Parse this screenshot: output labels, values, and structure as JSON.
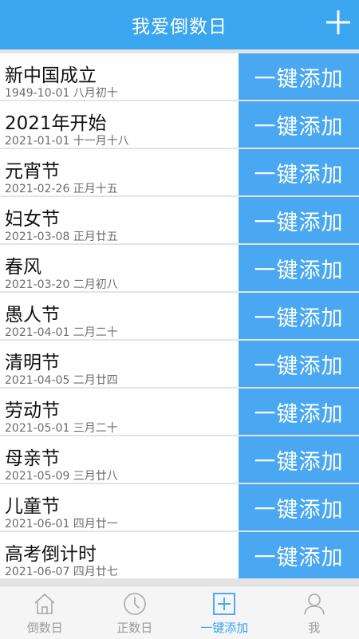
{
  "header": {
    "title": "我爱倒数日",
    "add_icon": "plus-icon"
  },
  "list": {
    "button_label": "一键添加",
    "items": [
      {
        "name": "新中国成立",
        "date": "1949-10-01 八月初十"
      },
      {
        "name": "2021年开始",
        "date": "2021-01-01 十一月十八"
      },
      {
        "name": "元宵节",
        "date": "2021-02-26 正月十五"
      },
      {
        "name": "妇女节",
        "date": "2021-03-08 正月廿五"
      },
      {
        "name": "春风",
        "date": "2021-03-20 二月初八"
      },
      {
        "name": "愚人节",
        "date": "2021-04-01 二月二十"
      },
      {
        "name": "清明节",
        "date": "2021-04-05 二月廿四"
      },
      {
        "name": "劳动节",
        "date": "2021-05-01 三月二十"
      },
      {
        "name": "母亲节",
        "date": "2021-05-09 三月廿八"
      },
      {
        "name": "儿童节",
        "date": "2021-06-01 四月廿一"
      },
      {
        "name": "高考倒计时",
        "date": "2021-06-07 四月廿七"
      }
    ]
  },
  "bottom_nav": {
    "items": [
      {
        "label": "倒数日",
        "icon": "home-icon",
        "active": false
      },
      {
        "label": "正数日",
        "icon": "clock-icon",
        "active": false
      },
      {
        "label": "一键添加",
        "icon": "add-box-icon",
        "active": true
      },
      {
        "label": "我",
        "icon": "user-icon",
        "active": false
      }
    ]
  },
  "colors": {
    "primary": "#3aa6f0",
    "button": "#4aa8f2",
    "inactive": "#9a9a9a"
  }
}
